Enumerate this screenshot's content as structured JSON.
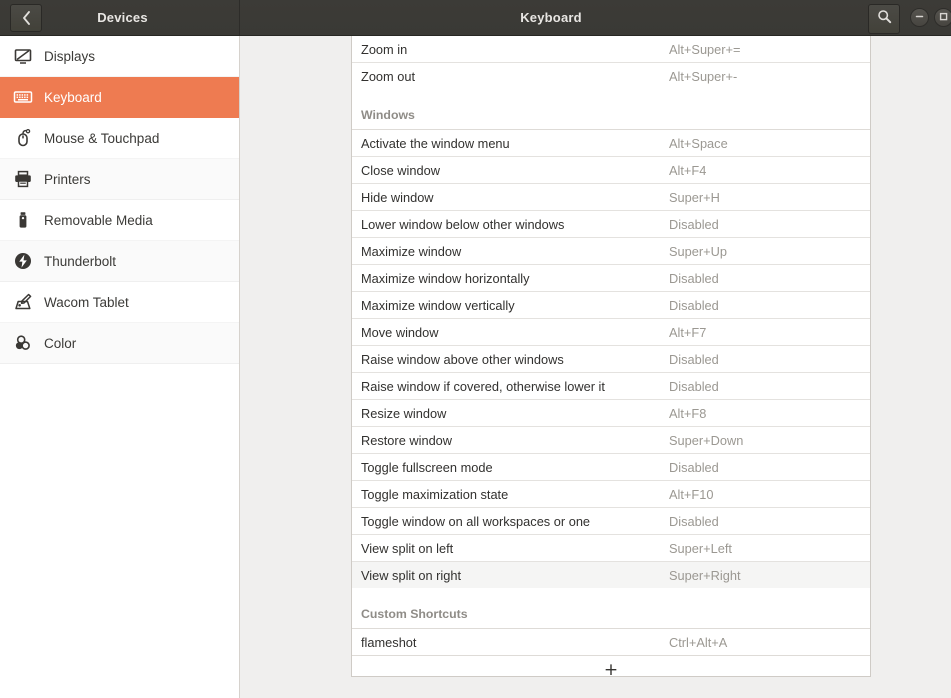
{
  "window": {
    "left_title": "Devices",
    "main_title": "Keyboard",
    "back_icon": "chevron-left-icon",
    "search_icon": "search-icon",
    "minimize_icon": "minimize-icon",
    "maximize_icon": "maximize-icon"
  },
  "sidebar": {
    "items": [
      {
        "label": "Displays",
        "icon": "display-icon",
        "selected": false
      },
      {
        "label": "Keyboard",
        "icon": "keyboard-icon",
        "selected": true
      },
      {
        "label": "Mouse & Touchpad",
        "icon": "mouse-icon",
        "selected": false
      },
      {
        "label": "Printers",
        "icon": "printer-icon",
        "selected": false
      },
      {
        "label": "Removable Media",
        "icon": "usb-drive-icon",
        "selected": false
      },
      {
        "label": "Thunderbolt",
        "icon": "thunderbolt-icon",
        "selected": false
      },
      {
        "label": "Wacom Tablet",
        "icon": "wacom-tablet-icon",
        "selected": false
      },
      {
        "label": "Color",
        "icon": "color-icon",
        "selected": false
      }
    ]
  },
  "shortcuts": {
    "add_button_glyph": "+",
    "add_button_name": "add-custom-shortcut-button",
    "blocks": [
      {
        "section": null,
        "rows": [
          {
            "name": "Zoom in",
            "key": "Alt+Super+=",
            "hovered": false
          },
          {
            "name": "Zoom out",
            "key": "Alt+Super+-",
            "hovered": false
          }
        ]
      },
      {
        "section": "Windows",
        "rows": [
          {
            "name": "Activate the window menu",
            "key": "Alt+Space",
            "hovered": false
          },
          {
            "name": "Close window",
            "key": "Alt+F4",
            "hovered": false
          },
          {
            "name": "Hide window",
            "key": "Super+H",
            "hovered": false
          },
          {
            "name": "Lower window below other windows",
            "key": "Disabled",
            "hovered": false
          },
          {
            "name": "Maximize window",
            "key": "Super+Up",
            "hovered": false
          },
          {
            "name": "Maximize window horizontally",
            "key": "Disabled",
            "hovered": false
          },
          {
            "name": "Maximize window vertically",
            "key": "Disabled",
            "hovered": false
          },
          {
            "name": "Move window",
            "key": "Alt+F7",
            "hovered": false
          },
          {
            "name": "Raise window above other windows",
            "key": "Disabled",
            "hovered": false
          },
          {
            "name": "Raise window if covered, otherwise lower it",
            "key": "Disabled",
            "hovered": false
          },
          {
            "name": "Resize window",
            "key": "Alt+F8",
            "hovered": false
          },
          {
            "name": "Restore window",
            "key": "Super+Down",
            "hovered": false
          },
          {
            "name": "Toggle fullscreen mode",
            "key": "Disabled",
            "hovered": false
          },
          {
            "name": "Toggle maximization state",
            "key": "Alt+F10",
            "hovered": false
          },
          {
            "name": "Toggle window on all workspaces or one",
            "key": "Disabled",
            "hovered": false
          },
          {
            "name": "View split on left",
            "key": "Super+Left",
            "hovered": false
          },
          {
            "name": "View split on right",
            "key": "Super+Right",
            "hovered": true
          }
        ]
      },
      {
        "section": "Custom Shortcuts",
        "rows": [
          {
            "name": "flameshot",
            "key": "Ctrl+Alt+A",
            "hovered": false
          }
        ]
      }
    ]
  },
  "colors": {
    "accent": "#ee7b51",
    "headerbar": "#3c3b37",
    "panel_bg": "#ffffff",
    "content_bg": "#f0efee",
    "key_text": "#9b9892",
    "section_text": "#8f8c87"
  }
}
